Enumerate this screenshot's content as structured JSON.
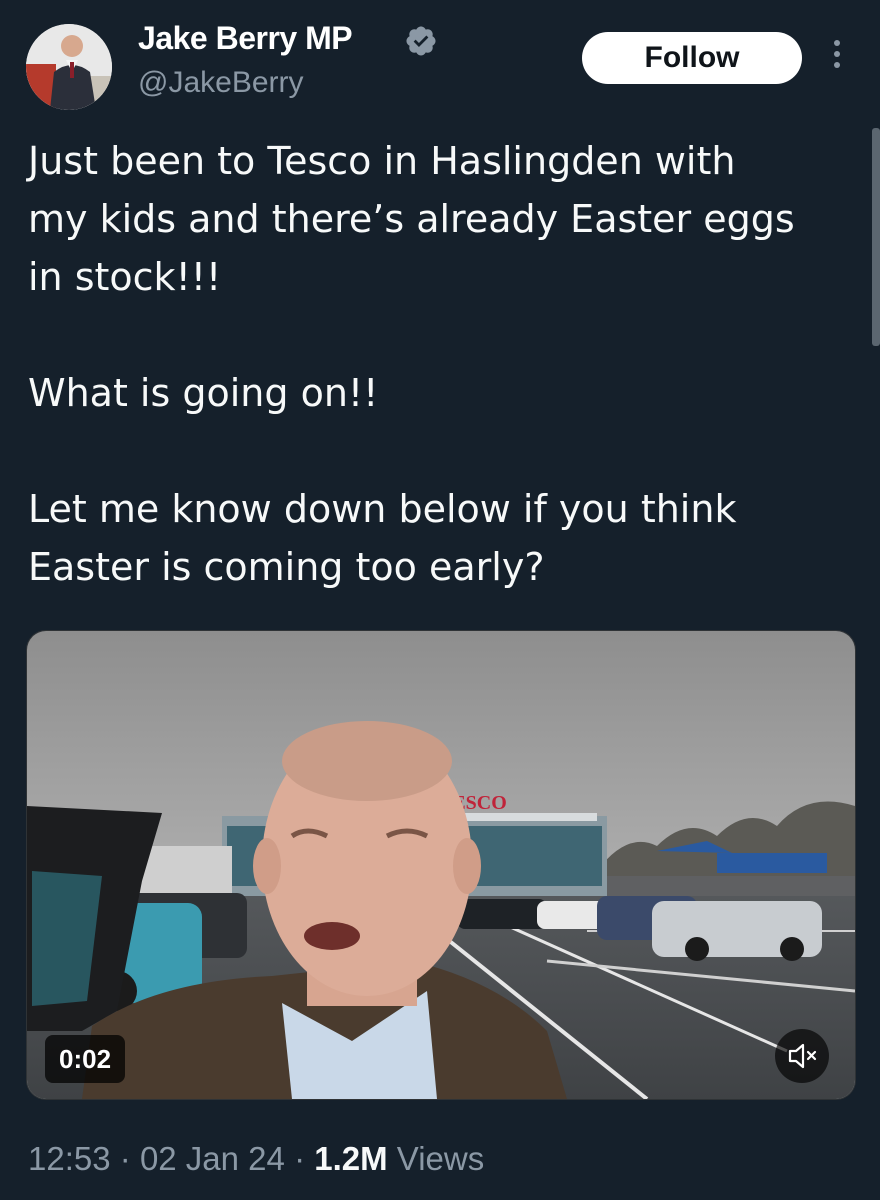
{
  "author": {
    "display_name": "Jake Berry MP",
    "handle": "@JakeBerry",
    "verified_icon": "verified-badge-icon",
    "avatar_icon": "profile-photo"
  },
  "actions": {
    "follow_label": "Follow",
    "more_icon": "more-options-icon"
  },
  "tweet": {
    "lines": [
      "Just been to Tesco in Haslingden with",
      "my kids and there’s already Easter eggs",
      "in stock!!!",
      "What is going on!!",
      "Let me know down below if you think",
      "Easter is coming too early?"
    ]
  },
  "media": {
    "type": "video",
    "store_sign": "TESCO",
    "timer": "0:02",
    "mute_icon": "speaker-muted-icon"
  },
  "meta": {
    "time": "12:53",
    "separator": "·",
    "date": "02 Jan 24",
    "views_count": "1.2M",
    "views_label": "Views"
  },
  "colors": {
    "background": "#15202b",
    "text_primary": "#f7f9f9",
    "text_secondary": "#8b98a5",
    "verified": "#8b98a5",
    "button_bg": "#ffffff"
  }
}
